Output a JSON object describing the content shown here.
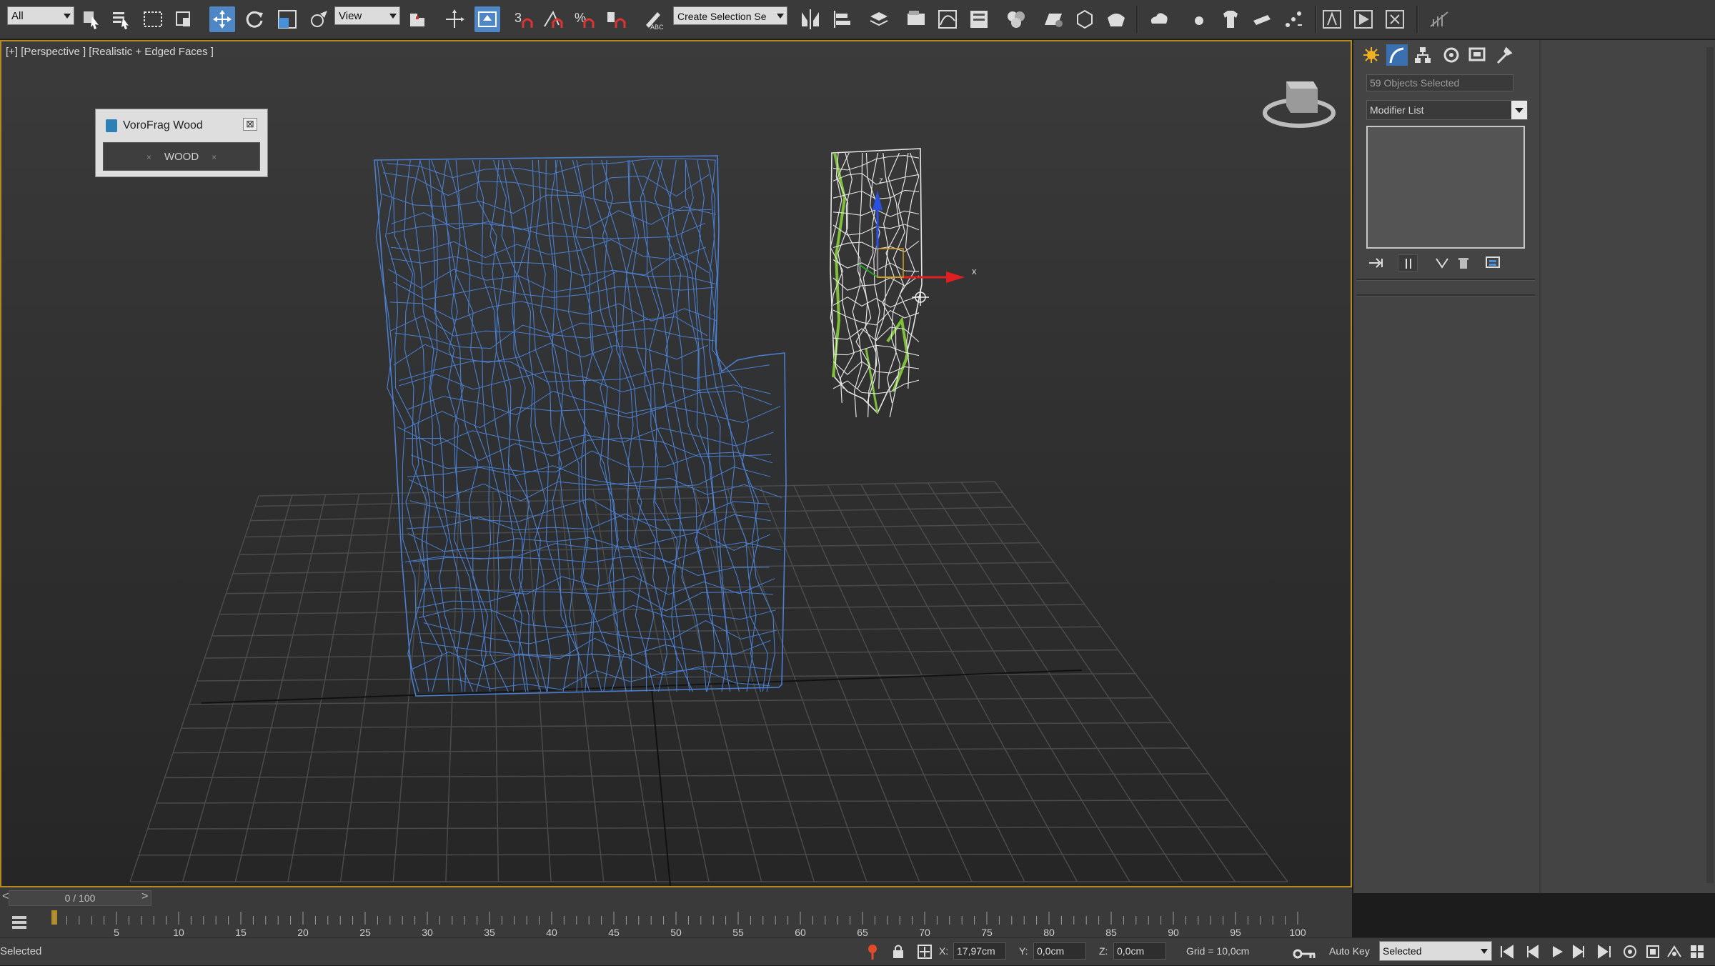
{
  "toolbar": {
    "filter_select": "All",
    "ref_coord": "View",
    "selection_set_placeholder": "Create Selection Se",
    "snap_angle_label": "3",
    "snap_angle_sub": "n"
  },
  "viewport": {
    "label": "[+] [Perspective ] [Realistic + Edged Faces ]",
    "gizmo_x_label": "x",
    "gizmo_z_label": "z"
  },
  "vorofrag": {
    "title": "VoroFrag Wood",
    "close": "⊠",
    "button": "WOOD",
    "button_x": "×"
  },
  "command_panel": {
    "selection_info": "59 Objects Selected",
    "modifier_list": "Modifier List",
    "selection_color": "#3f86e0"
  },
  "timeline": {
    "frame_display": "0 / 100",
    "prev": "<",
    "next": ">",
    "ticks": [
      "5",
      "10",
      "15",
      "20",
      "25",
      "30",
      "35",
      "40",
      "45",
      "50",
      "55",
      "60",
      "65",
      "70",
      "75",
      "80",
      "85",
      "90",
      "95",
      "100"
    ]
  },
  "status": {
    "text": "Selected",
    "x_label": "X:",
    "x_value": "17,97cm",
    "y_label": "Y:",
    "y_value": "0,0cm",
    "z_label": "Z:",
    "z_value": "0,0cm",
    "grid": "Grid = 10,0cm",
    "auto_key": "Auto Key",
    "key_mode": "Selected"
  },
  "colors": {
    "viewport_border": "#b58a1e",
    "wire_blue": "#4c7fd0",
    "active_tool": "#4f86c6"
  }
}
